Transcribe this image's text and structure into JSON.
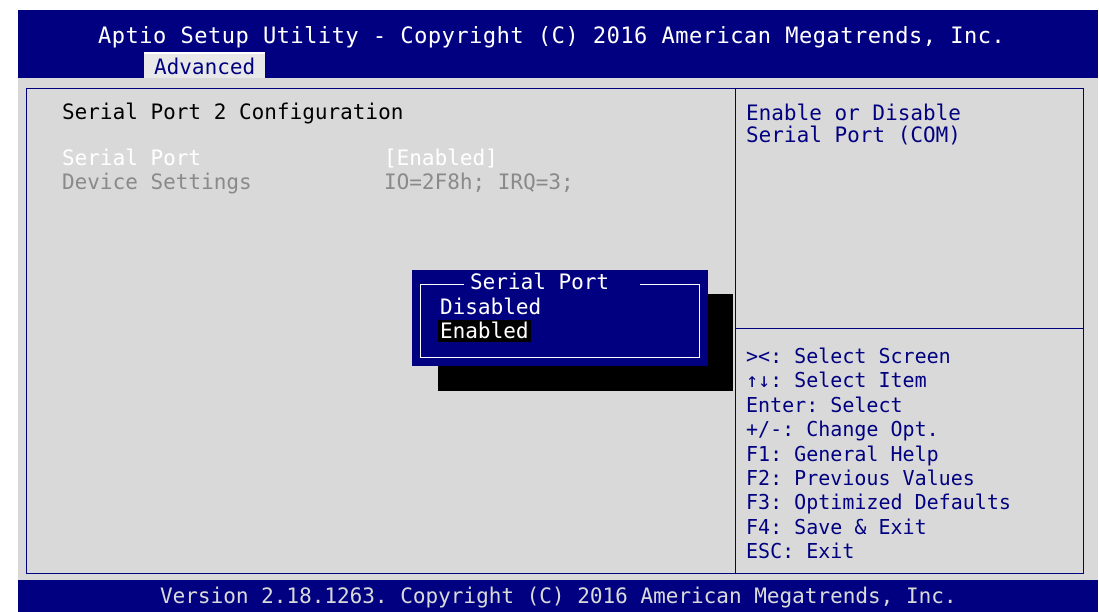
{
  "header": {
    "title": "Aptio Setup Utility - Copyright (C) 2016 American Megatrends, Inc.",
    "active_tab": "Advanced"
  },
  "main": {
    "section_title": "Serial Port 2 Configuration",
    "rows": [
      {
        "label": "Serial Port",
        "value": "[Enabled]"
      },
      {
        "label": "Device Settings",
        "value": "IO=2F8h; IRQ=3;"
      }
    ]
  },
  "popup": {
    "title": "Serial Port",
    "options": [
      "Disabled",
      "Enabled"
    ],
    "selected": "Enabled"
  },
  "help": {
    "lines": [
      "Enable or Disable",
      "Serial Port (COM)"
    ]
  },
  "keys": [
    "><: Select Screen",
    "↑↓: Select Item",
    "Enter: Select",
    "+/-: Change Opt.",
    "F1: General Help",
    "F2: Previous Values",
    "F3: Optimized Defaults",
    "F4: Save & Exit",
    "ESC: Exit"
  ],
  "footer": {
    "text": "Version 2.18.1263. Copyright (C) 2016 American Megatrends, Inc."
  },
  "colors": {
    "bios_blue": "#000080",
    "panel_gray": "#d9d9d9",
    "selected_white": "#ffffff",
    "disabled_gray": "#8a8a8a"
  }
}
